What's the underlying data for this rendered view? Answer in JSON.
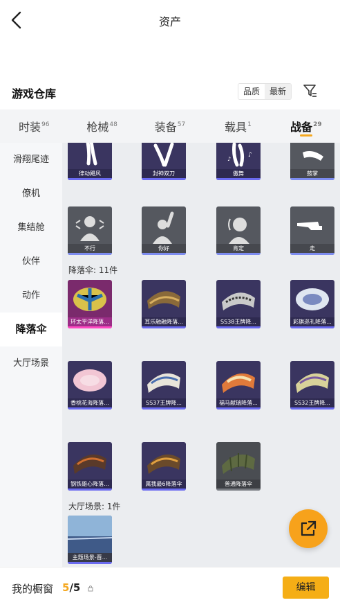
{
  "header": {
    "title": "资产"
  },
  "section": {
    "title": "游戏仓库",
    "sort_quality": "品质",
    "sort_latest": "最新"
  },
  "tabs": [
    {
      "label": "时装",
      "count": "96"
    },
    {
      "label": "枪械",
      "count": "48"
    },
    {
      "label": "装备",
      "count": "57"
    },
    {
      "label": "载具",
      "count": "1"
    },
    {
      "label": "战备",
      "count": "29"
    }
  ],
  "sidebar": [
    "滑翔尾迹",
    "僚机",
    "集结舱",
    "伙伴",
    "动作",
    "降落伞",
    "大厅场景"
  ],
  "emotes_row1": [
    "律动飓风",
    "封神双刀",
    "傲舞",
    "鼓掌"
  ],
  "emotes_row2": [
    "不行",
    "你好",
    "肯定",
    "走"
  ],
  "parachute_label": "降落伞: 11件",
  "parachutes": [
    "环太平洋降落...",
    "耳乐融融降落...",
    "SS38王牌降...",
    "彩旗巡礼降落...",
    "香桃花海降落...",
    "SS37王牌降...",
    "福马献瑞降落...",
    "SS32王牌降...",
    "钢铁雄心降落...",
    "属我最6降落伞",
    "普通降落伞"
  ],
  "scene_label": "大厅场景: 1件",
  "scenes": [
    "主题场景-晋..."
  ],
  "bottom": {
    "window_label": "我的橱窗",
    "count_current": "5",
    "count_sep": "/",
    "count_max": "5",
    "edit_label": "编辑"
  },
  "colors": {
    "accent": "#f5a81f",
    "pink_highlight": "#ff4ac2",
    "rarity_blue": "#6b6bf0"
  },
  "icons": [
    "back-arrow-icon",
    "filter-icon",
    "share-icon",
    "lock-icon"
  ]
}
